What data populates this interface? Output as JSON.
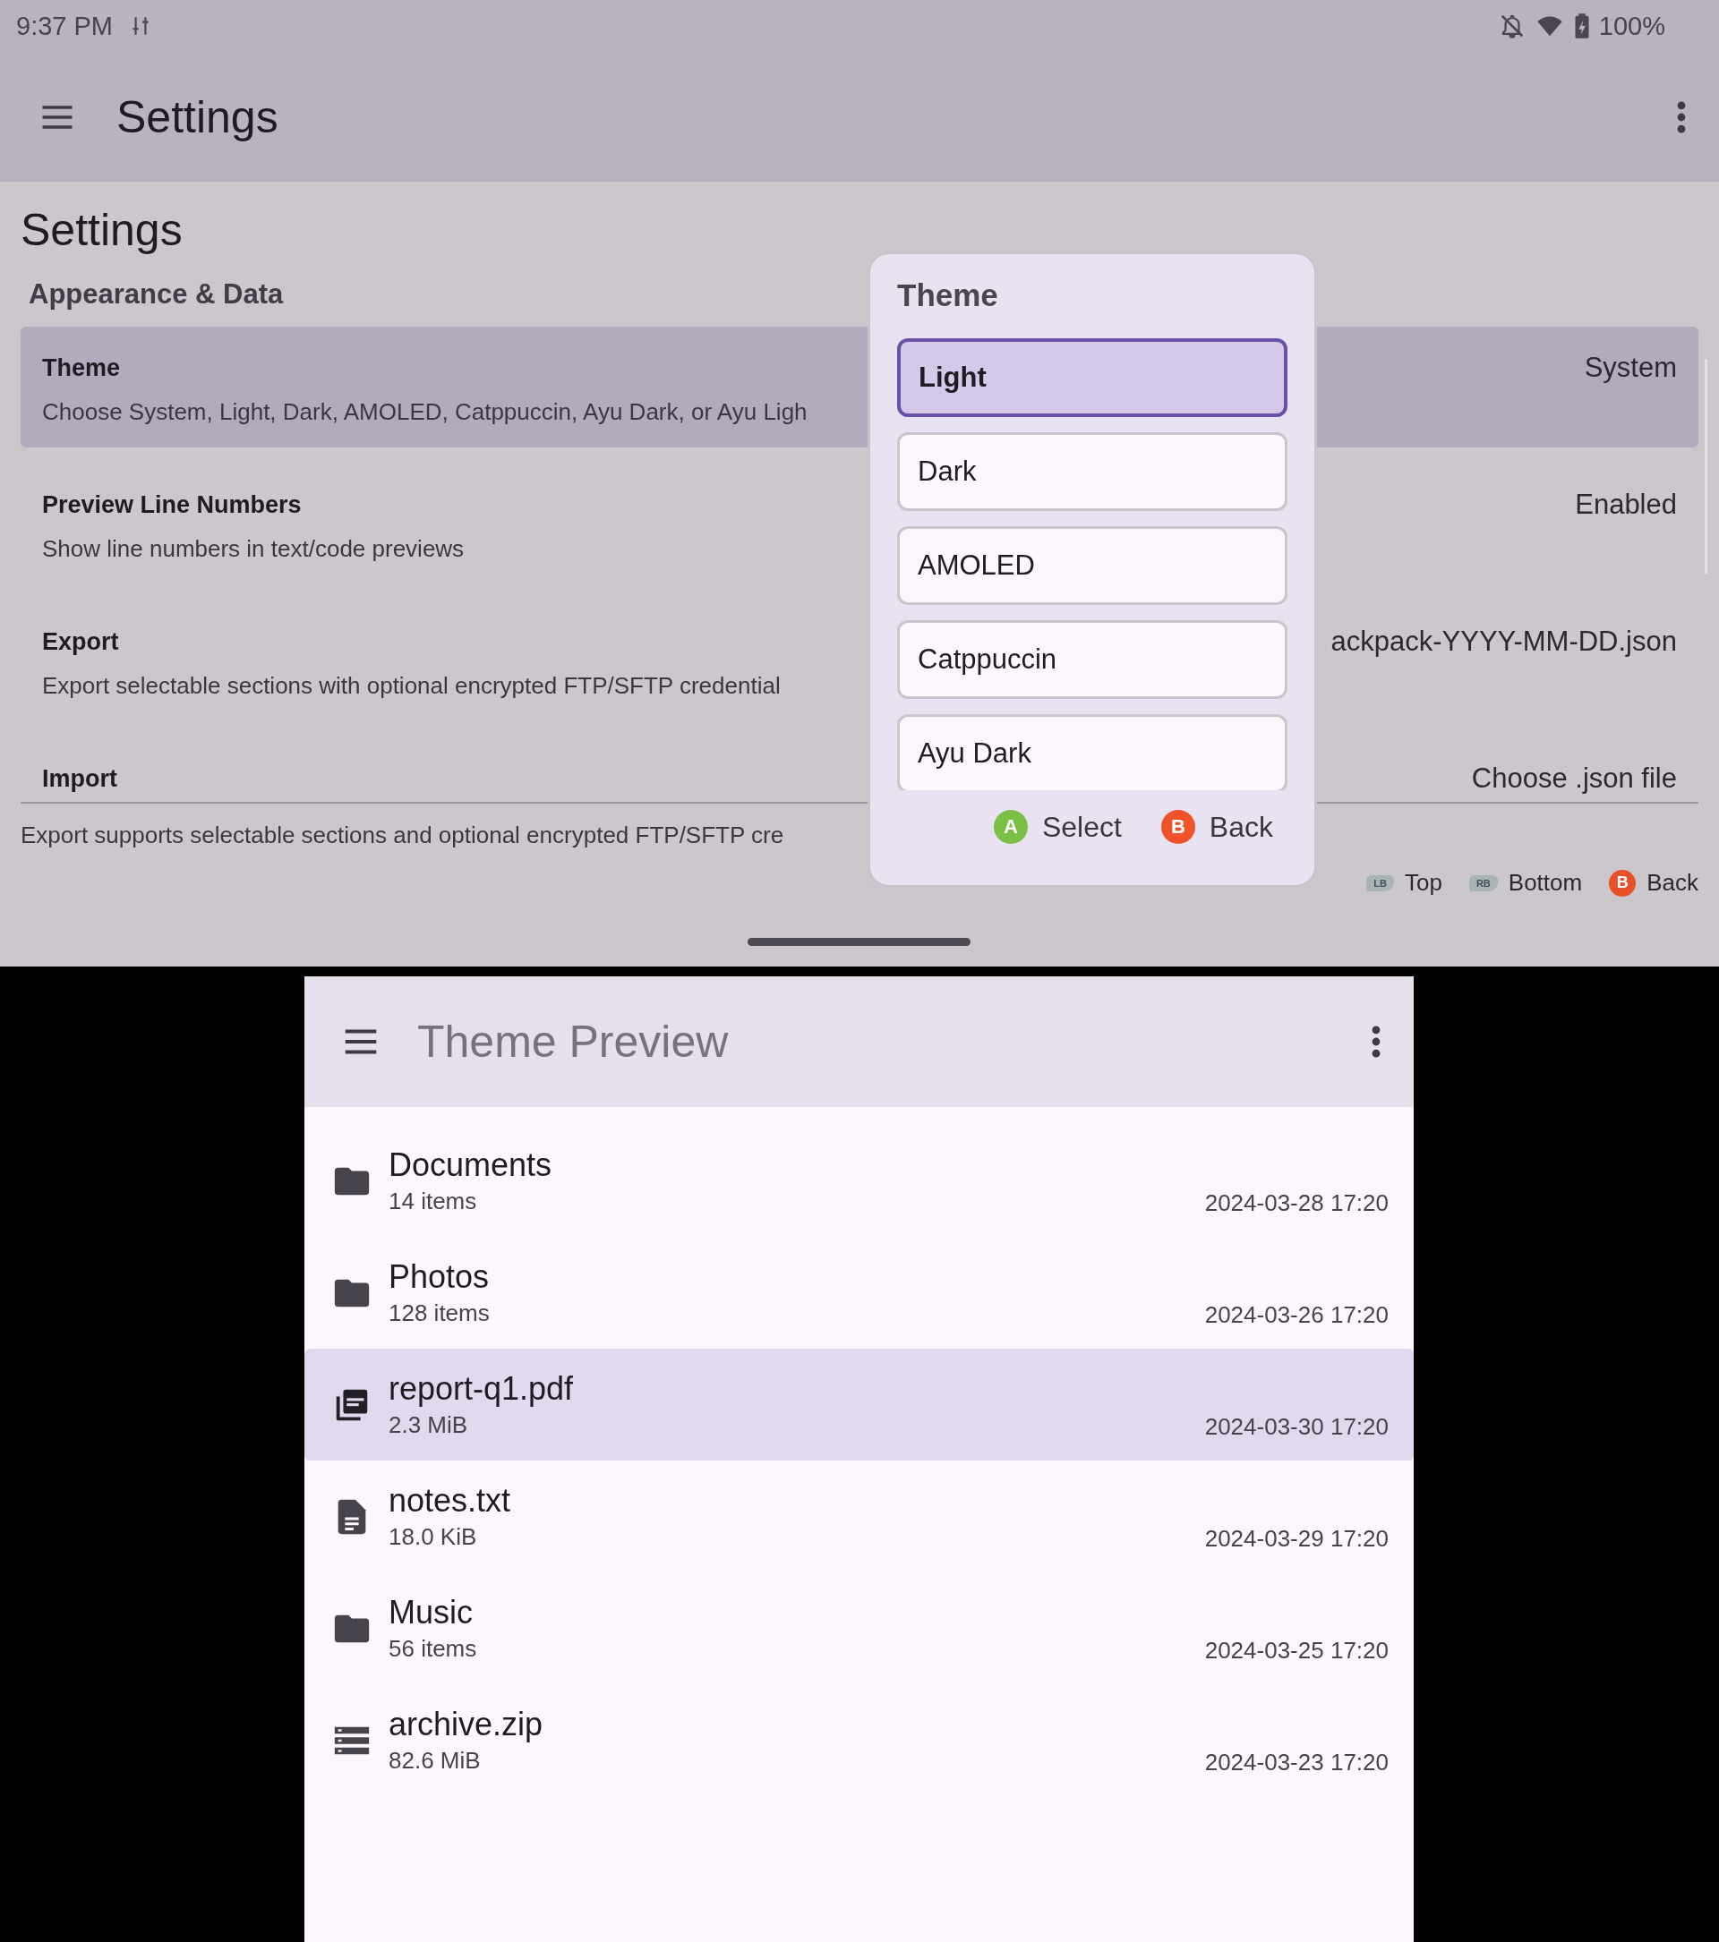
{
  "status_bar": {
    "time": "9:37 PM",
    "battery": "100%"
  },
  "app_bar": {
    "title": "Settings"
  },
  "page": {
    "heading": "Settings",
    "section": "Appearance & Data",
    "items": [
      {
        "title": "Theme",
        "description": "Choose System, Light, Dark, AMOLED, Catppuccin, Ayu Dark, or Ayu Ligh",
        "value": "System",
        "selected": true
      },
      {
        "title": "Preview Line Numbers",
        "description": "Show line numbers in text/code previews",
        "value": "Enabled",
        "selected": false
      },
      {
        "title": "Export",
        "description": "Export selectable sections with optional encrypted FTP/SFTP credential",
        "value": "ackpack-YYYY-MM-DD.json",
        "selected": false
      },
      {
        "title": "Import",
        "value": "Choose .json file",
        "selected": false
      }
    ],
    "footer": "Export supports selectable sections and optional encrypted FTP/SFTP cre",
    "hints": [
      {
        "kind": "bumper",
        "key": "LB",
        "label": "Top",
        "color": "#a9b4b6"
      },
      {
        "kind": "bumper",
        "key": "RB",
        "label": "Bottom",
        "color": "#a9b4b6"
      },
      {
        "kind": "face",
        "key": "B",
        "label": "Back",
        "color": "#e8502a"
      }
    ]
  },
  "dialog": {
    "title": "Theme",
    "options": [
      {
        "label": "Light",
        "selected": true
      },
      {
        "label": "Dark",
        "selected": false
      },
      {
        "label": "AMOLED",
        "selected": false
      },
      {
        "label": "Catppuccin",
        "selected": false
      },
      {
        "label": "Ayu Dark",
        "selected": false
      }
    ],
    "actions": [
      {
        "key": "A",
        "label": "Select",
        "color": "#7cbf45"
      },
      {
        "key": "B",
        "label": "Back",
        "color": "#f0532a"
      }
    ]
  },
  "preview": {
    "title": "Theme Preview",
    "files": [
      {
        "kind": "folder",
        "name": "Documents",
        "detail": "14 items",
        "date": "2024-03-28 17:20",
        "selected": false
      },
      {
        "kind": "folder",
        "name": "Photos",
        "detail": "128 items",
        "date": "2024-03-26 17:20",
        "selected": false
      },
      {
        "kind": "pdf",
        "name": "report-q1.pdf",
        "detail": "2.3 MiB",
        "date": "2024-03-30 17:20",
        "selected": true
      },
      {
        "kind": "text",
        "name": "notes.txt",
        "detail": "18.0 KiB",
        "date": "2024-03-29 17:20",
        "selected": false
      },
      {
        "kind": "folder",
        "name": "Music",
        "detail": "56 items",
        "date": "2024-03-25 17:20",
        "selected": false
      },
      {
        "kind": "archive",
        "name": "archive.zip",
        "detail": "82.6 MiB",
        "date": "2024-03-23 17:20",
        "selected": false
      }
    ]
  }
}
